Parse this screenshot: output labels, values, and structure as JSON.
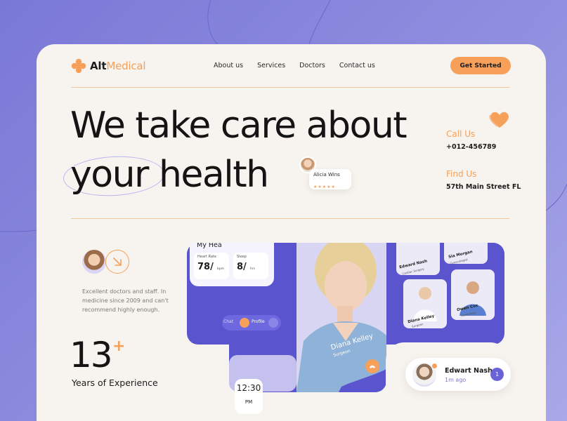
{
  "brand": {
    "name_bold": "Alt",
    "name_light": "Medical"
  },
  "nav": {
    "items": [
      "About us",
      "Services",
      "Doctors",
      "Contact us"
    ]
  },
  "header": {
    "cta_label": "Get Started"
  },
  "hero": {
    "line1": "We take care about",
    "line2_highlight": "your",
    "line2_rest": "health"
  },
  "review": {
    "name": "Alicia Wins",
    "stars": "★★★★★",
    "rating": 5
  },
  "contact": {
    "call_label": "Call Us",
    "call_value": "+012-456789",
    "find_label": "Find Us",
    "find_value": "57th Main Street FL"
  },
  "testimonial": {
    "text": "Excellent doctors and staff. In medicine since 2009 and can't recommend highly enough."
  },
  "stats": {
    "value": "13",
    "suffix": "+",
    "label": "Years of Experience"
  },
  "app_preview": {
    "card_title": "My Hea",
    "heart_rate_label": "Heart Rate",
    "heart_rate_value": "78/",
    "heart_rate_unit": "bpm",
    "sleep_label": "Sleep",
    "sleep_value": "8/",
    "sleep_unit": "hrs",
    "pill_left": "Chat",
    "pill_right": "Profile",
    "clock_time": "12:30",
    "clock_period": "PM",
    "doctor_name": "Diana Kelley",
    "doctor_role": "Surgeon",
    "doctors": [
      {
        "name": "Edward Nash",
        "spec": "Cardiac Surgery"
      },
      {
        "name": "Sia Morgan",
        "spec": "Gynecologist"
      },
      {
        "name": "Diana Kelley",
        "spec": "Surgeon"
      },
      {
        "name": "Owen Cox",
        "spec": "Cardiology"
      }
    ]
  },
  "notification": {
    "name": "Edwart Nash",
    "time": "1m ago",
    "count": "1"
  },
  "colors": {
    "accent": "#f6a05a",
    "primary": "#5a54cf",
    "background": "#f7f3ee"
  }
}
